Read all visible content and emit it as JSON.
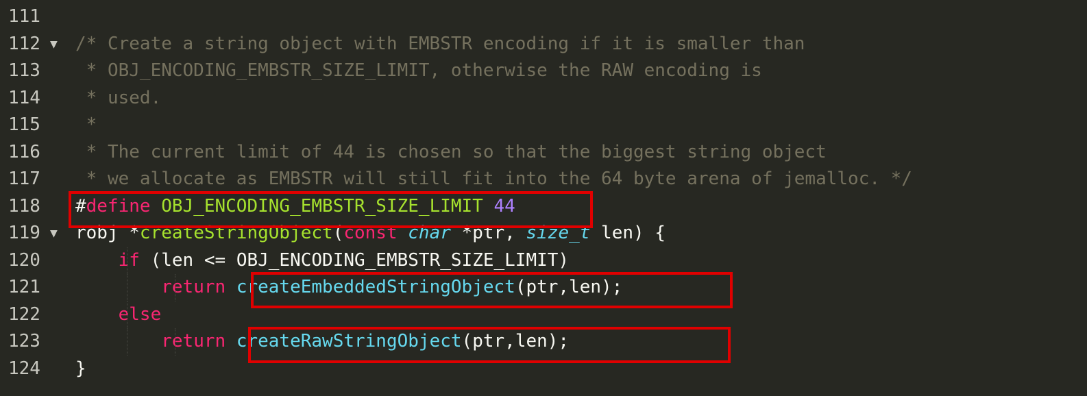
{
  "editor": {
    "lines": [
      {
        "num": "111",
        "fold": "",
        "parts": []
      },
      {
        "num": "112",
        "fold": "▼",
        "parts": [
          {
            "cls": "comment",
            "text": "/* Create a string object with EMBSTR encoding if it is smaller than"
          }
        ]
      },
      {
        "num": "113",
        "fold": "",
        "parts": [
          {
            "cls": "comment",
            "text": " * OBJ_ENCODING_EMBSTR_SIZE_LIMIT, otherwise the RAW encoding is"
          }
        ]
      },
      {
        "num": "114",
        "fold": "",
        "parts": [
          {
            "cls": "comment",
            "text": " * used."
          }
        ]
      },
      {
        "num": "115",
        "fold": "",
        "parts": [
          {
            "cls": "comment",
            "text": " *"
          }
        ]
      },
      {
        "num": "116",
        "fold": "",
        "parts": [
          {
            "cls": "comment",
            "text": " * The current limit of 44 is chosen so that the biggest string object"
          }
        ]
      },
      {
        "num": "117",
        "fold": "",
        "parts": [
          {
            "cls": "comment",
            "text": " * we allocate as EMBSTR will still fit into the 64 byte arena of jemalloc. */"
          }
        ]
      },
      {
        "num": "118",
        "fold": "",
        "parts": [
          {
            "cls": "",
            "text": "#"
          },
          {
            "cls": "keyword",
            "text": "define"
          },
          {
            "cls": "",
            "text": " "
          },
          {
            "cls": "str-green",
            "text": "OBJ_ENCODING_EMBSTR_SIZE_LIMIT"
          },
          {
            "cls": "",
            "text": " "
          },
          {
            "cls": "num",
            "text": "44"
          }
        ]
      },
      {
        "num": "119",
        "fold": "▼",
        "parts": [
          {
            "cls": "",
            "text": "robj *"
          },
          {
            "cls": "str-green",
            "text": "createStringObject"
          },
          {
            "cls": "",
            "text": "("
          },
          {
            "cls": "keyword",
            "text": "const"
          },
          {
            "cls": "",
            "text": " "
          },
          {
            "cls": "type-italic",
            "text": "char"
          },
          {
            "cls": "",
            "text": " *ptr, "
          },
          {
            "cls": "type-italic",
            "text": "size_t"
          },
          {
            "cls": "",
            "text": " len) {"
          }
        ]
      },
      {
        "num": "120",
        "fold": "",
        "parts": [
          {
            "cls": "",
            "text": "    "
          },
          {
            "cls": "keyword",
            "text": "if"
          },
          {
            "cls": "",
            "text": " (len <= OBJ_ENCODING_EMBSTR_SIZE_LIMIT)"
          }
        ]
      },
      {
        "num": "121",
        "fold": "",
        "parts": [
          {
            "cls": "",
            "text": "        "
          },
          {
            "cls": "keyword",
            "text": "return"
          },
          {
            "cls": "",
            "text": " "
          },
          {
            "cls": "fn",
            "text": "createEmbeddedStringObject"
          },
          {
            "cls": "",
            "text": "(ptr,len);"
          }
        ]
      },
      {
        "num": "122",
        "fold": "",
        "parts": [
          {
            "cls": "",
            "text": "    "
          },
          {
            "cls": "keyword",
            "text": "else"
          }
        ]
      },
      {
        "num": "123",
        "fold": "",
        "parts": [
          {
            "cls": "",
            "text": "        "
          },
          {
            "cls": "keyword",
            "text": "return"
          },
          {
            "cls": "",
            "text": " "
          },
          {
            "cls": "fn",
            "text": "createRawStringObject"
          },
          {
            "cls": "",
            "text": "(ptr,len);"
          }
        ]
      },
      {
        "num": "124",
        "fold": "",
        "parts": [
          {
            "cls": "",
            "text": "}"
          }
        ]
      }
    ]
  },
  "colors": {
    "background": "#272822",
    "highlight_box": "#E00000",
    "comment": "#75715E",
    "keyword": "#F92672",
    "function": "#66D9EF",
    "entity": "#A6E22E",
    "number": "#AE81FF"
  }
}
